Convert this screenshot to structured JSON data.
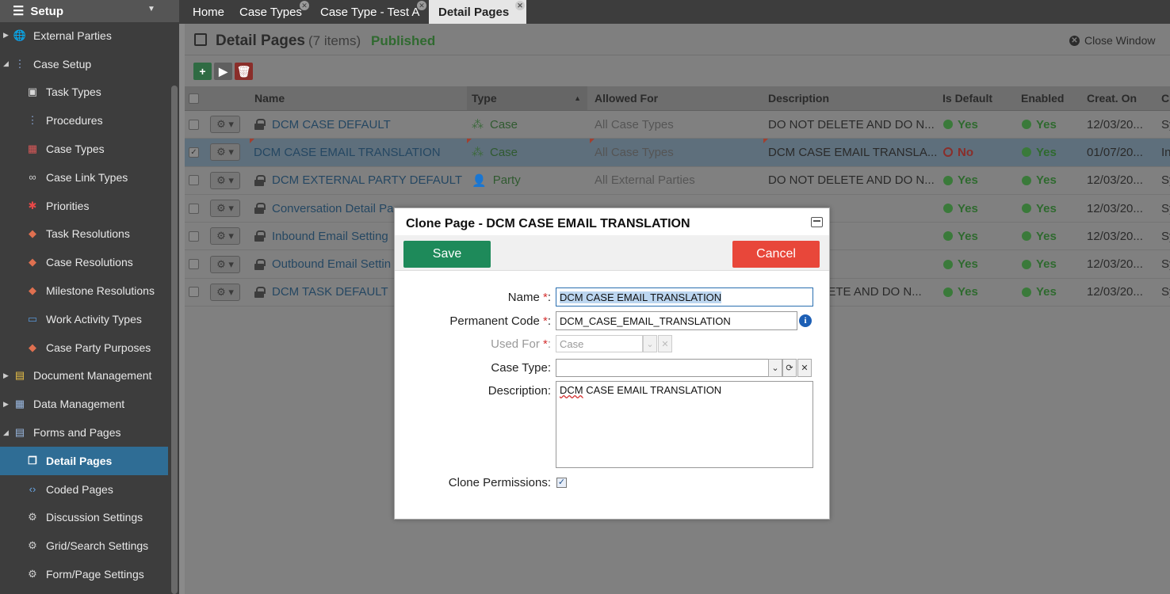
{
  "sidebar": {
    "header": "Setup",
    "items": [
      {
        "label": "External Parties",
        "icon": "globe-icon",
        "level": 0,
        "arrow": "expand"
      },
      {
        "label": "Case Setup",
        "icon": "tree-icon",
        "level": 0,
        "arrow": "collapse"
      },
      {
        "label": "Task Types",
        "icon": "box-icon",
        "level": 1
      },
      {
        "label": "Procedures",
        "icon": "tree-icon",
        "level": 1
      },
      {
        "label": "Case Types",
        "icon": "cubes-icon",
        "level": 1
      },
      {
        "label": "Case Link Types",
        "icon": "link-icon",
        "level": 1
      },
      {
        "label": "Priorities",
        "icon": "asterisk-icon",
        "level": 1
      },
      {
        "label": "Task Resolutions",
        "icon": "tag-icon",
        "level": 1
      },
      {
        "label": "Case Resolutions",
        "icon": "tag-icon",
        "level": 1
      },
      {
        "label": "Milestone Resolutions",
        "icon": "tag-icon",
        "level": 1
      },
      {
        "label": "Work Activity Types",
        "icon": "tray-icon",
        "level": 1
      },
      {
        "label": "Case Party Purposes",
        "icon": "tag-icon",
        "level": 1
      },
      {
        "label": "Document Management",
        "icon": "folder-icon",
        "level": 0,
        "arrow": "expand"
      },
      {
        "label": "Data Management",
        "icon": "table-icon",
        "level": 0,
        "arrow": "expand"
      },
      {
        "label": "Forms and Pages",
        "icon": "form-icon",
        "level": 0,
        "arrow": "collapse"
      },
      {
        "label": "Detail Pages",
        "icon": "pages-icon",
        "level": 1,
        "active": true
      },
      {
        "label": "Coded Pages",
        "icon": "code-icon",
        "level": 1
      },
      {
        "label": "Discussion Settings",
        "icon": "gear-icon",
        "level": 1
      },
      {
        "label": "Grid/Search Settings",
        "icon": "gear-icon",
        "level": 1
      },
      {
        "label": "Form/Page Settings",
        "icon": "gear-icon",
        "level": 1
      }
    ]
  },
  "tabs": [
    {
      "label": "Home",
      "closable": false,
      "active": false
    },
    {
      "label": "Case Types",
      "closable": true,
      "active": false
    },
    {
      "label": "Case Type - Test A",
      "closable": true,
      "active": false
    },
    {
      "label": "Detail Pages",
      "closable": true,
      "active": true
    }
  ],
  "page": {
    "title": "Detail Pages",
    "count": "(7 items)",
    "status": "Published",
    "close_window": "Close Window"
  },
  "grid": {
    "columns": [
      "Name",
      "Type",
      "Allowed For",
      "Description",
      "Is Default",
      "Enabled",
      "Creat. On",
      "Cr"
    ],
    "rows": [
      {
        "name": "DCM CASE DEFAULT",
        "locked": true,
        "type": "Case",
        "type_icon": "cubes-icon",
        "allowed_for": "All Case Types",
        "description": "DO NOT DELETE AND DO N...",
        "is_default": "Yes",
        "enabled": "Yes",
        "created": "12/03/20...",
        "creator": "Sy",
        "selected": false
      },
      {
        "name": "DCM CASE EMAIL TRANSLATION",
        "locked": false,
        "type": "Case",
        "type_icon": "cubes-icon",
        "allowed_for": "All Case Types",
        "description": "DCM CASE EMAIL TRANSLA...",
        "is_default": "No",
        "enabled": "Yes",
        "created": "01/07/20...",
        "creator": "In",
        "selected": true
      },
      {
        "name": "DCM EXTERNAL PARTY DEFAULT",
        "locked": true,
        "type": "Party",
        "type_icon": "person-icon",
        "allowed_for": "All External Parties",
        "description": "DO NOT DELETE AND DO N...",
        "is_default": "Yes",
        "enabled": "Yes",
        "created": "12/03/20...",
        "creator": "Sy",
        "selected": false
      },
      {
        "name": "Conversation Detail Pa",
        "locked": true,
        "type": "",
        "type_icon": "",
        "allowed_for": "",
        "description": "",
        "is_default": "Yes",
        "enabled": "Yes",
        "created": "12/03/20...",
        "creator": "Sy",
        "selected": false
      },
      {
        "name": "Inbound Email Setting",
        "locked": true,
        "type": "",
        "type_icon": "",
        "allowed_for": "",
        "description": "",
        "is_default": "Yes",
        "enabled": "Yes",
        "created": "12/03/20...",
        "creator": "Sy",
        "selected": false
      },
      {
        "name": "Outbound Email Settin",
        "locked": true,
        "type": "",
        "type_icon": "",
        "allowed_for": "",
        "description": "",
        "is_default": "Yes",
        "enabled": "Yes",
        "created": "12/03/20...",
        "creator": "Sy",
        "selected": false
      },
      {
        "name": "DCM TASK DEFAULT",
        "locked": true,
        "type": "",
        "type_icon": "",
        "allowed_for": "",
        "description": "ELETE AND DO N...",
        "is_default": "Yes",
        "enabled": "Yes",
        "created": "12/03/20...",
        "creator": "Sy",
        "selected": false
      }
    ]
  },
  "modal": {
    "title": "Clone Page - DCM CASE EMAIL TRANSLATION",
    "save_label": "Save",
    "cancel_label": "Cancel",
    "name_label": "Name",
    "name_value": "DCM CASE EMAIL TRANSLATION",
    "code_label": "Permanent Code",
    "code_value": "DCM_CASE_EMAIL_TRANSLATION",
    "used_for_label": "Used For",
    "used_for_value": "Case",
    "case_type_label": "Case Type:",
    "case_type_value": "",
    "description_label": "Description:",
    "description_first_word": "DCM",
    "description_rest": " CASE EMAIL TRANSLATION",
    "clone_permissions_label": "Clone Permissions:",
    "clone_permissions_checked": true,
    "required_marker": "*",
    "colon": ":"
  },
  "colors": {
    "save": "#1e8a5a",
    "cancel": "#e8473a",
    "active_sidebar": "#2f6d95",
    "required": "#d43030"
  }
}
